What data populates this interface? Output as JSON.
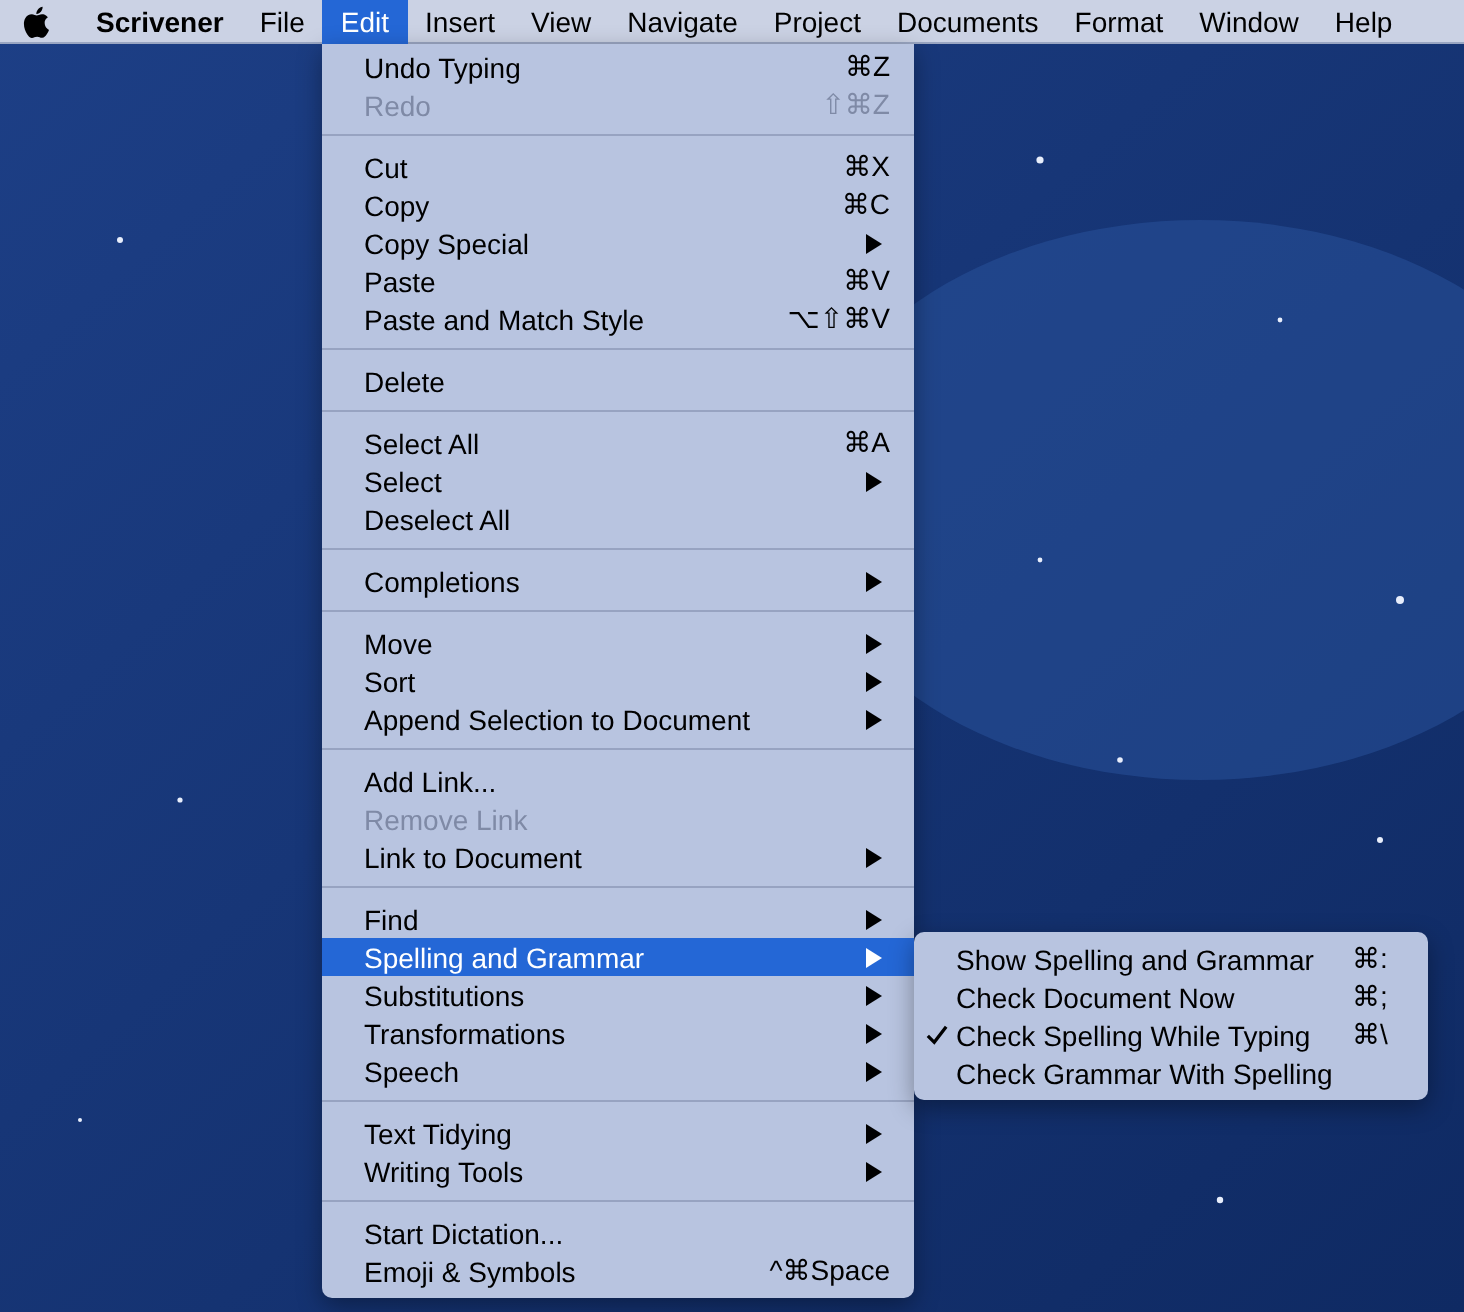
{
  "menubar": {
    "items": [
      {
        "label": "Scrivener",
        "kind": "app",
        "selected": false
      },
      {
        "label": "File",
        "kind": "menu",
        "selected": false
      },
      {
        "label": "Edit",
        "kind": "menu",
        "selected": true
      },
      {
        "label": "Insert",
        "kind": "menu",
        "selected": false
      },
      {
        "label": "View",
        "kind": "menu",
        "selected": false
      },
      {
        "label": "Navigate",
        "kind": "menu",
        "selected": false
      },
      {
        "label": "Project",
        "kind": "menu",
        "selected": false
      },
      {
        "label": "Documents",
        "kind": "menu",
        "selected": false
      },
      {
        "label": "Format",
        "kind": "menu",
        "selected": false
      },
      {
        "label": "Window",
        "kind": "menu",
        "selected": false
      },
      {
        "label": "Help",
        "kind": "menu",
        "selected": false
      }
    ]
  },
  "edit_menu": {
    "groups": [
      [
        {
          "label": "Undo Typing",
          "shortcut": "⌘Z",
          "disabled": false,
          "submenu": false,
          "selected": false
        },
        {
          "label": "Redo",
          "shortcut": "⇧⌘Z",
          "disabled": true,
          "submenu": false,
          "selected": false
        }
      ],
      [
        {
          "label": "Cut",
          "shortcut": "⌘X",
          "disabled": false,
          "submenu": false,
          "selected": false
        },
        {
          "label": "Copy",
          "shortcut": "⌘C",
          "disabled": false,
          "submenu": false,
          "selected": false
        },
        {
          "label": "Copy Special",
          "disabled": false,
          "submenu": true,
          "selected": false
        },
        {
          "label": "Paste",
          "shortcut": "⌘V",
          "disabled": false,
          "submenu": false,
          "selected": false
        },
        {
          "label": "Paste and Match Style",
          "shortcut": "⌥⇧⌘V",
          "disabled": false,
          "submenu": false,
          "selected": false
        }
      ],
      [
        {
          "label": "Delete",
          "disabled": false,
          "submenu": false,
          "selected": false
        }
      ],
      [
        {
          "label": "Select All",
          "shortcut": "⌘A",
          "disabled": false,
          "submenu": false,
          "selected": false
        },
        {
          "label": "Select",
          "disabled": false,
          "submenu": true,
          "selected": false
        },
        {
          "label": "Deselect All",
          "disabled": false,
          "submenu": false,
          "selected": false
        }
      ],
      [
        {
          "label": "Completions",
          "disabled": false,
          "submenu": true,
          "selected": false
        }
      ],
      [
        {
          "label": "Move",
          "disabled": false,
          "submenu": true,
          "selected": false
        },
        {
          "label": "Sort",
          "disabled": false,
          "submenu": true,
          "selected": false
        },
        {
          "label": "Append Selection to Document",
          "disabled": false,
          "submenu": true,
          "selected": false
        }
      ],
      [
        {
          "label": "Add Link...",
          "disabled": false,
          "submenu": false,
          "selected": false
        },
        {
          "label": "Remove Link",
          "disabled": true,
          "submenu": false,
          "selected": false
        },
        {
          "label": "Link to Document",
          "disabled": false,
          "submenu": true,
          "selected": false
        }
      ],
      [
        {
          "label": "Find",
          "disabled": false,
          "submenu": true,
          "selected": false
        },
        {
          "label": "Spelling and Grammar",
          "disabled": false,
          "submenu": true,
          "selected": true
        },
        {
          "label": "Substitutions",
          "disabled": false,
          "submenu": true,
          "selected": false
        },
        {
          "label": "Transformations",
          "disabled": false,
          "submenu": true,
          "selected": false
        },
        {
          "label": "Speech",
          "disabled": false,
          "submenu": true,
          "selected": false
        }
      ],
      [
        {
          "label": "Text Tidying",
          "disabled": false,
          "submenu": true,
          "selected": false
        },
        {
          "label": "Writing Tools",
          "disabled": false,
          "submenu": true,
          "selected": false
        }
      ],
      [
        {
          "label": "Start Dictation...",
          "disabled": false,
          "submenu": false,
          "selected": false
        },
        {
          "label": "Emoji & Symbols",
          "shortcut": "^⌘Space",
          "disabled": false,
          "submenu": false,
          "selected": false
        }
      ]
    ]
  },
  "spelling_submenu": {
    "items": [
      {
        "label": "Show Spelling and Grammar",
        "shortcut": "⌘:",
        "checked": false
      },
      {
        "label": "Check Document Now",
        "shortcut": "⌘;",
        "checked": false
      },
      {
        "label": "Check Spelling While Typing",
        "shortcut": "⌘\\",
        "checked": true
      },
      {
        "label": "Check Grammar With Spelling",
        "checked": false
      }
    ]
  }
}
